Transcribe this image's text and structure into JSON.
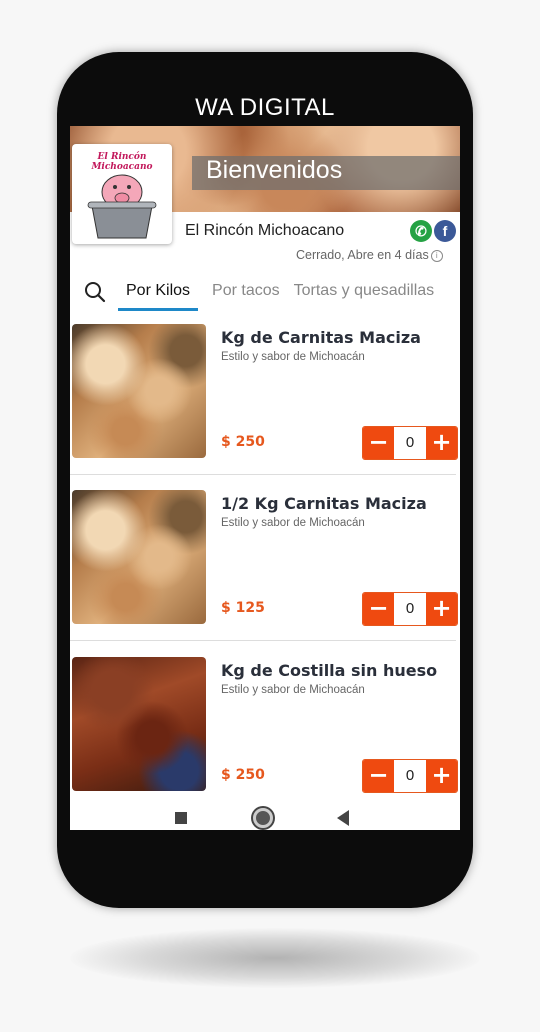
{
  "frame_brand": "WA DIGITAL",
  "header": {
    "welcome": "Bienvenidos",
    "logo_text": "El Rincón Michoacano",
    "restaurant_name": "El Rincón Michoacano",
    "status": "Cerrado, Abre en 4 días",
    "whatsapp_glyph": "✆",
    "facebook_glyph": "f"
  },
  "tabs": [
    {
      "label": "Por Kilos",
      "active": true
    },
    {
      "label": "Por tacos",
      "active": false
    },
    {
      "label": "Tortas y quesadillas",
      "active": false
    }
  ],
  "items": [
    {
      "title": "Kg de Carnitas Maciza",
      "desc": "Estilo y sabor de Michoacán",
      "price": "$ 250",
      "qty": "0"
    },
    {
      "title": "1/2 Kg Carnitas Maciza",
      "desc": "Estilo y sabor de Michoacán",
      "price": "$ 125",
      "qty": "0"
    },
    {
      "title": "Kg de Costilla sin hueso",
      "desc": "Estilo y sabor de Michoacán",
      "price": "$ 250",
      "qty": "0"
    }
  ],
  "stepper": {
    "minus": "−",
    "plus": "+"
  },
  "icons": {
    "search": "search-icon",
    "info": "info-icon",
    "nav_home": "home-icon",
    "nav_recent": "recent-apps-icon",
    "nav_back": "back-icon"
  },
  "colors": {
    "accent": "#ef4a10",
    "price": "#e6581e",
    "tab_underline": "#1e88c8"
  }
}
